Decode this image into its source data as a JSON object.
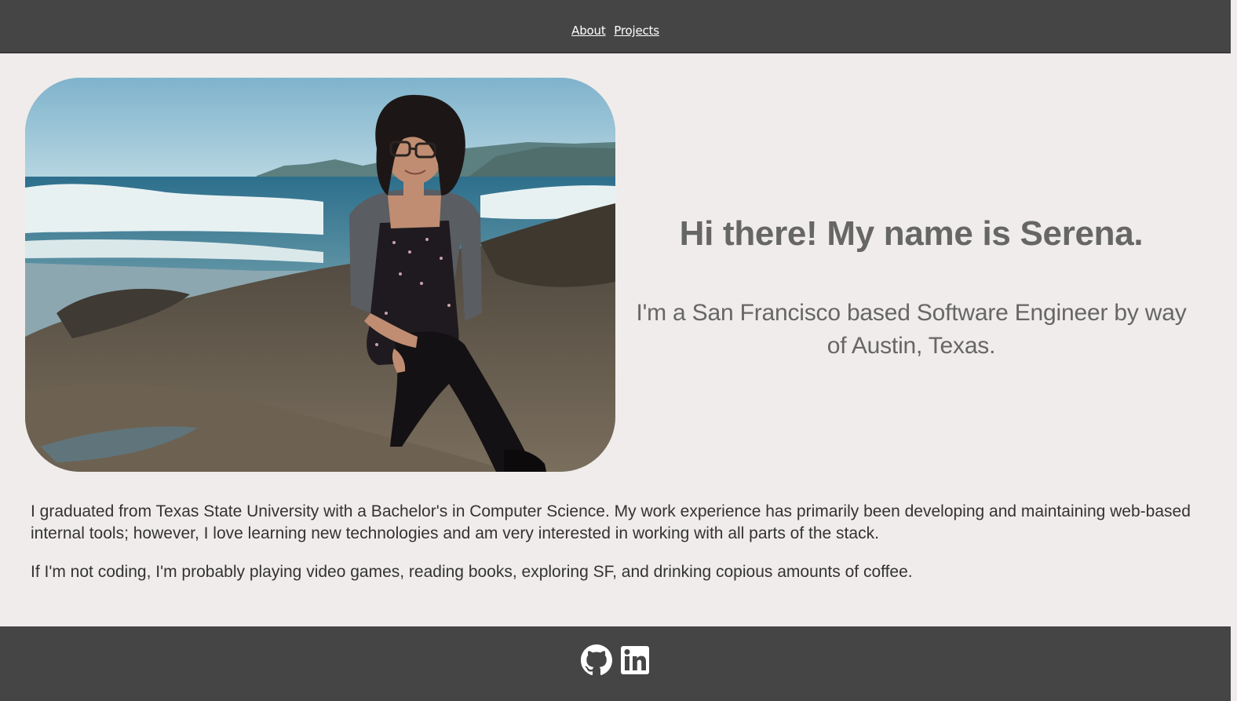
{
  "nav": {
    "about": "About",
    "projects": "Projects"
  },
  "hero": {
    "title": "Hi there! My name is Serena.",
    "subtitle": "I'm a San Francisco based Software Engineer by way of Austin, Texas.",
    "photo_alt": "Serena sitting on rocks at the beach"
  },
  "bio": {
    "paragraph1": "I graduated from Texas State University with a Bachelor's in Computer Science. My work experience has primarily been developing and maintaining web-based internal tools; however, I love learning new technologies and am very interested in working with all parts of the stack.",
    "paragraph2": "If I'm not coding, I'm probably playing video games, reading books, exploring SF, and drinking copious amounts of coffee."
  },
  "footer": {
    "icons": [
      "github-icon",
      "linkedin-icon"
    ]
  },
  "colors": {
    "header_bg": "#454545",
    "page_bg": "#f0eceb",
    "hero_text": "#666666",
    "body_text": "#333333"
  }
}
